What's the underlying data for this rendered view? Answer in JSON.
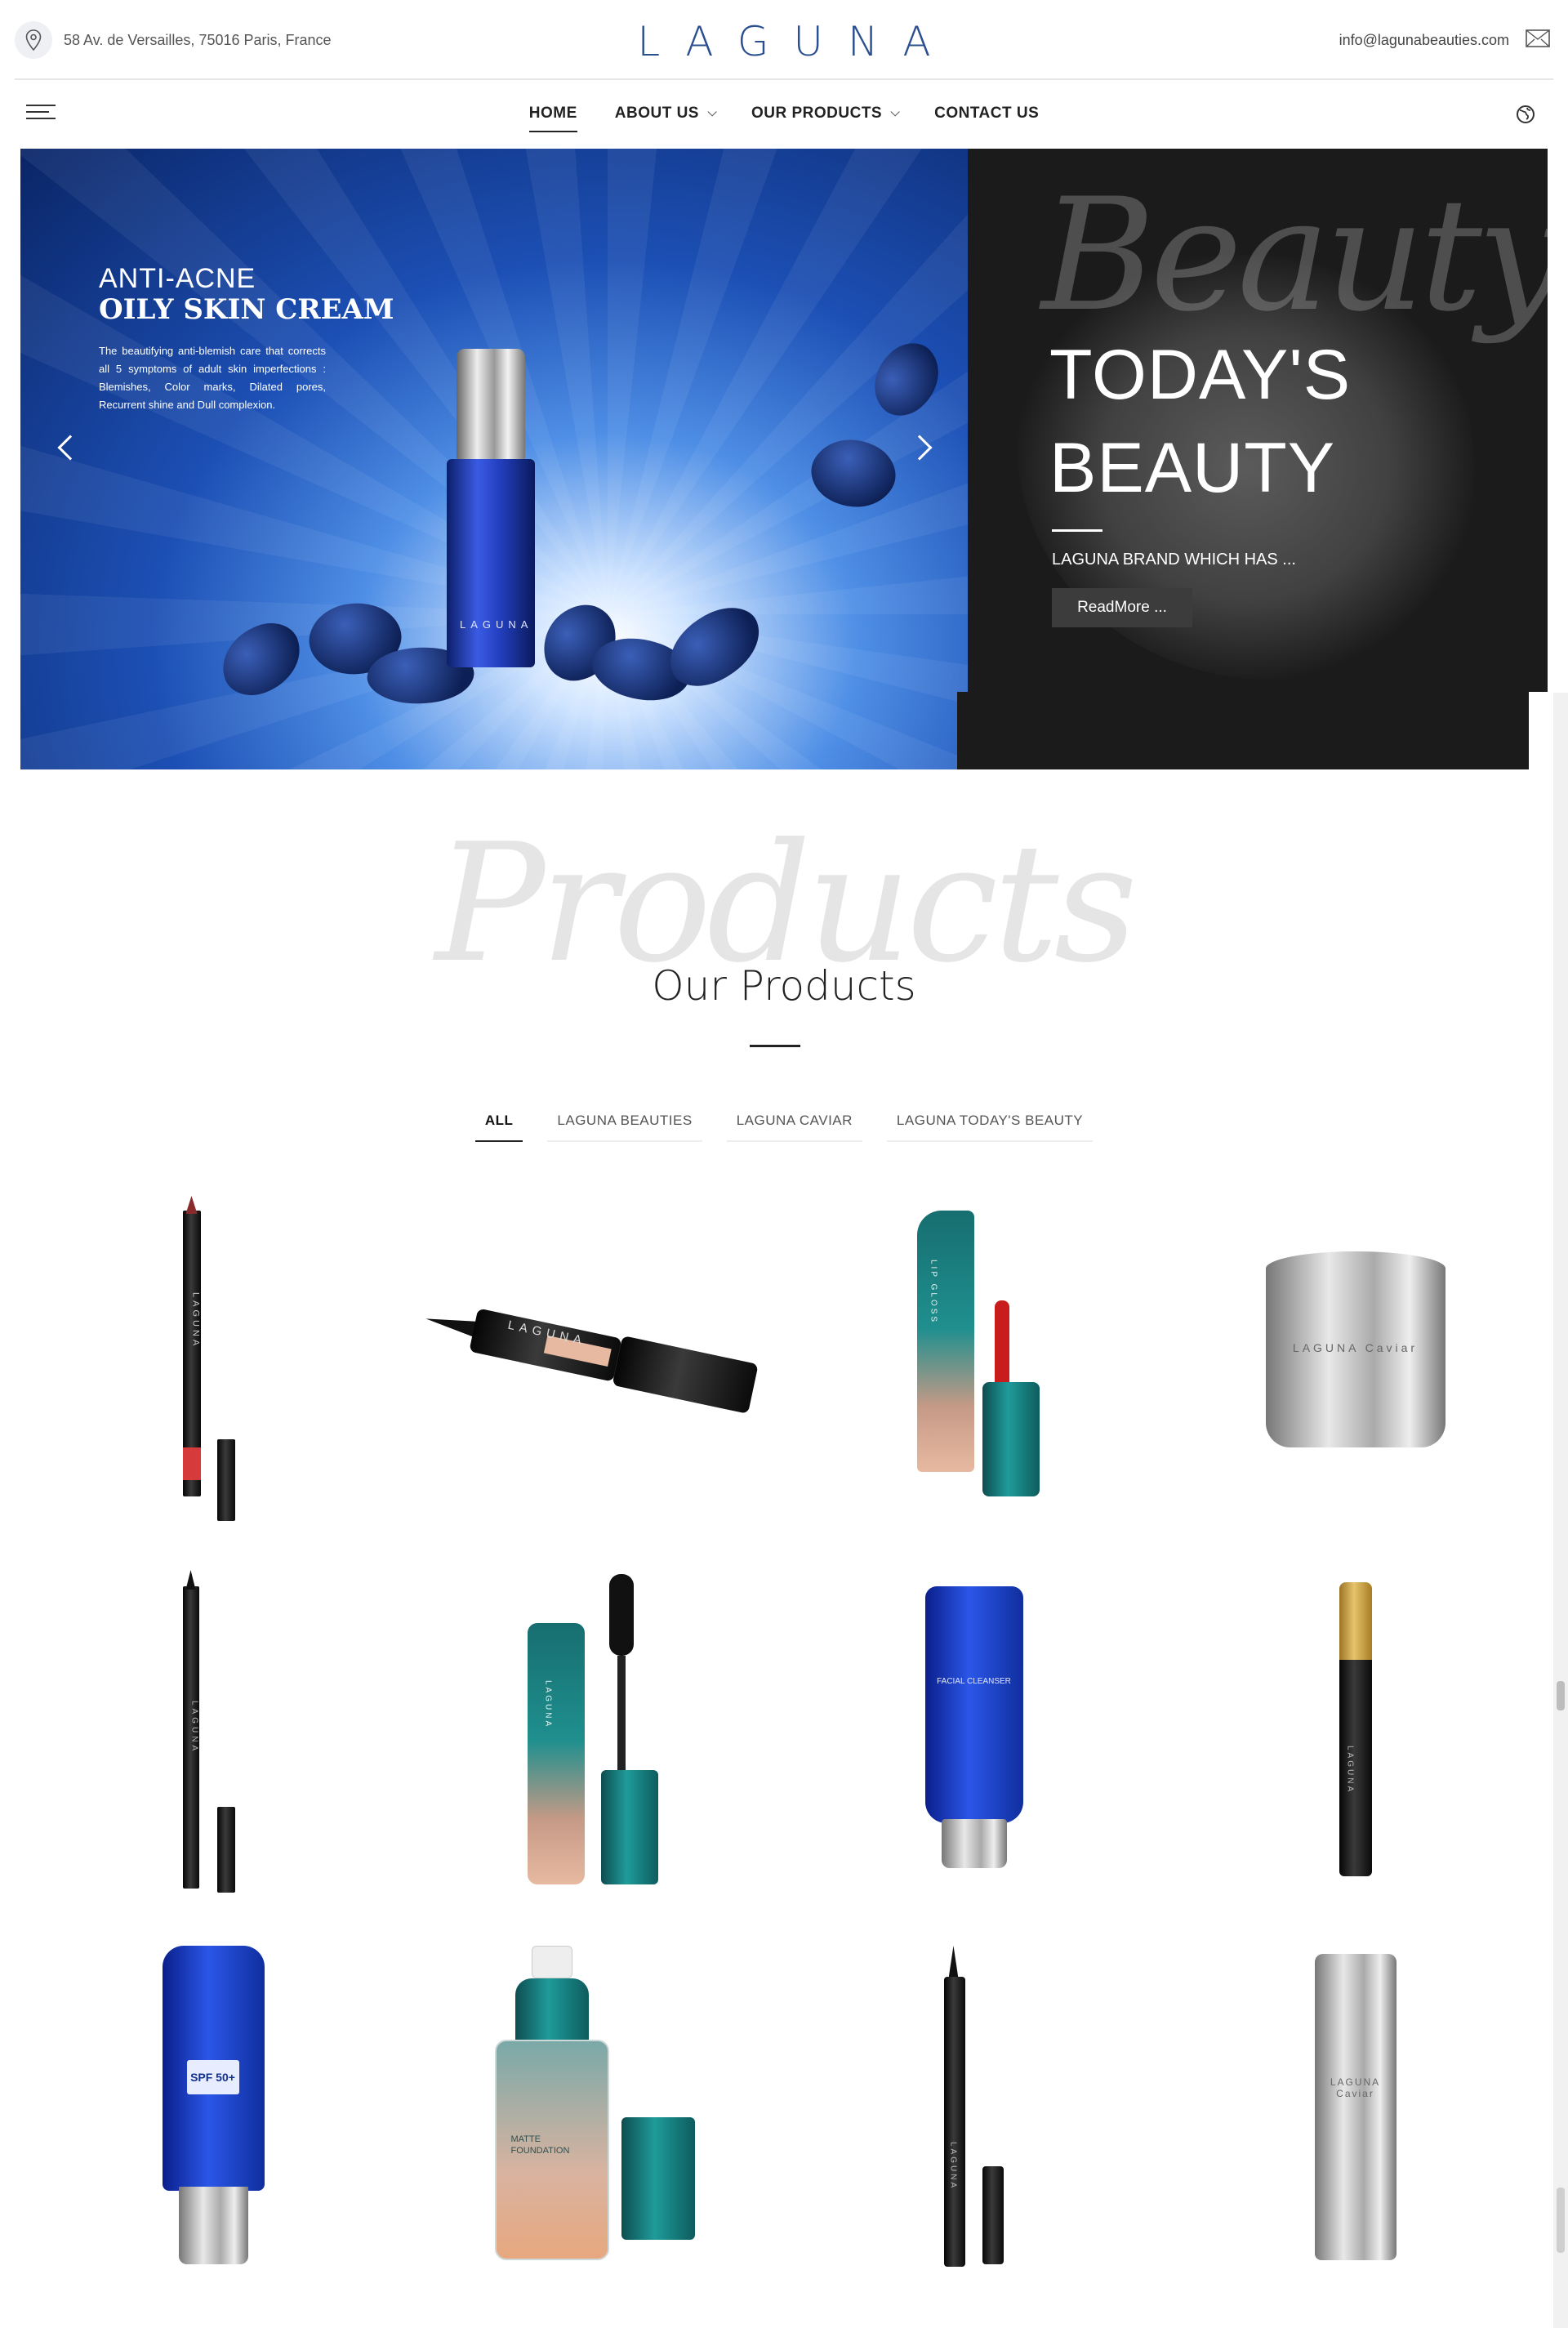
{
  "header": {
    "address": "58 Av. de Versailles, 75016 Paris, France",
    "logo": "LAGUNA",
    "email": "info@lagunabeauties.com"
  },
  "nav": {
    "items": [
      {
        "label": "HOME",
        "active": true,
        "dropdown": false
      },
      {
        "label": "ABOUT US",
        "active": false,
        "dropdown": true
      },
      {
        "label": "OUR PRODUCTS",
        "active": false,
        "dropdown": true
      },
      {
        "label": "CONTACT US",
        "active": false,
        "dropdown": false
      }
    ]
  },
  "hero": {
    "slide": {
      "line1": "ANTI-ACNE",
      "line2": "OILY SKIN CREAM",
      "body": "The beautifying anti-blemish care that corrects all 5 symptoms of adult skin imperfections : Blemishes, Color marks, Dilated pores, Recurrent shine and Dull complexion.",
      "bottle_label": "LAGUNA"
    },
    "panel": {
      "script": "Beauty",
      "title_line1": "TODAY'S",
      "title_line2": "BEAUTY",
      "subtitle": "LAGUNA BRAND WHICH HAS ...",
      "button": "ReadMore ..."
    }
  },
  "products": {
    "script": "Products",
    "title": "Our Products",
    "filters": [
      "ALL",
      "LAGUNA BEAUTIES",
      "LAGUNA CAVIAR",
      "LAGUNA TODAY'S BEAUTY"
    ],
    "active_filter": "ALL",
    "items": [
      {
        "name": "lip-liner-pencil",
        "label": "LAGUNA"
      },
      {
        "name": "eyeliner-stamp",
        "label": "LAGUNA"
      },
      {
        "name": "lip-gloss",
        "label": "LIP GLOSS"
      },
      {
        "name": "caviar-cream-jar",
        "label": "LAGUNA Caviar"
      },
      {
        "name": "eyeliner-pencil",
        "label": "LAGUNA"
      },
      {
        "name": "mascara",
        "label": "LAGUNA"
      },
      {
        "name": "facial-cleanser-tube",
        "label": "FACIAL CLEANSER"
      },
      {
        "name": "concealer-pen",
        "label": "LAGUNA"
      },
      {
        "name": "sunscreen-cream",
        "label": "SPF 50+"
      },
      {
        "name": "matte-foundation",
        "label": "MATTE FOUNDATION"
      },
      {
        "name": "liquid-eyeliner",
        "label": "LAGUNA"
      },
      {
        "name": "caviar-serum",
        "label": "LAGUNA Caviar"
      }
    ]
  },
  "colors": {
    "brand_blue": "#2b4f8f",
    "dark_panel": "#1b1b1b",
    "text": "#222222"
  }
}
